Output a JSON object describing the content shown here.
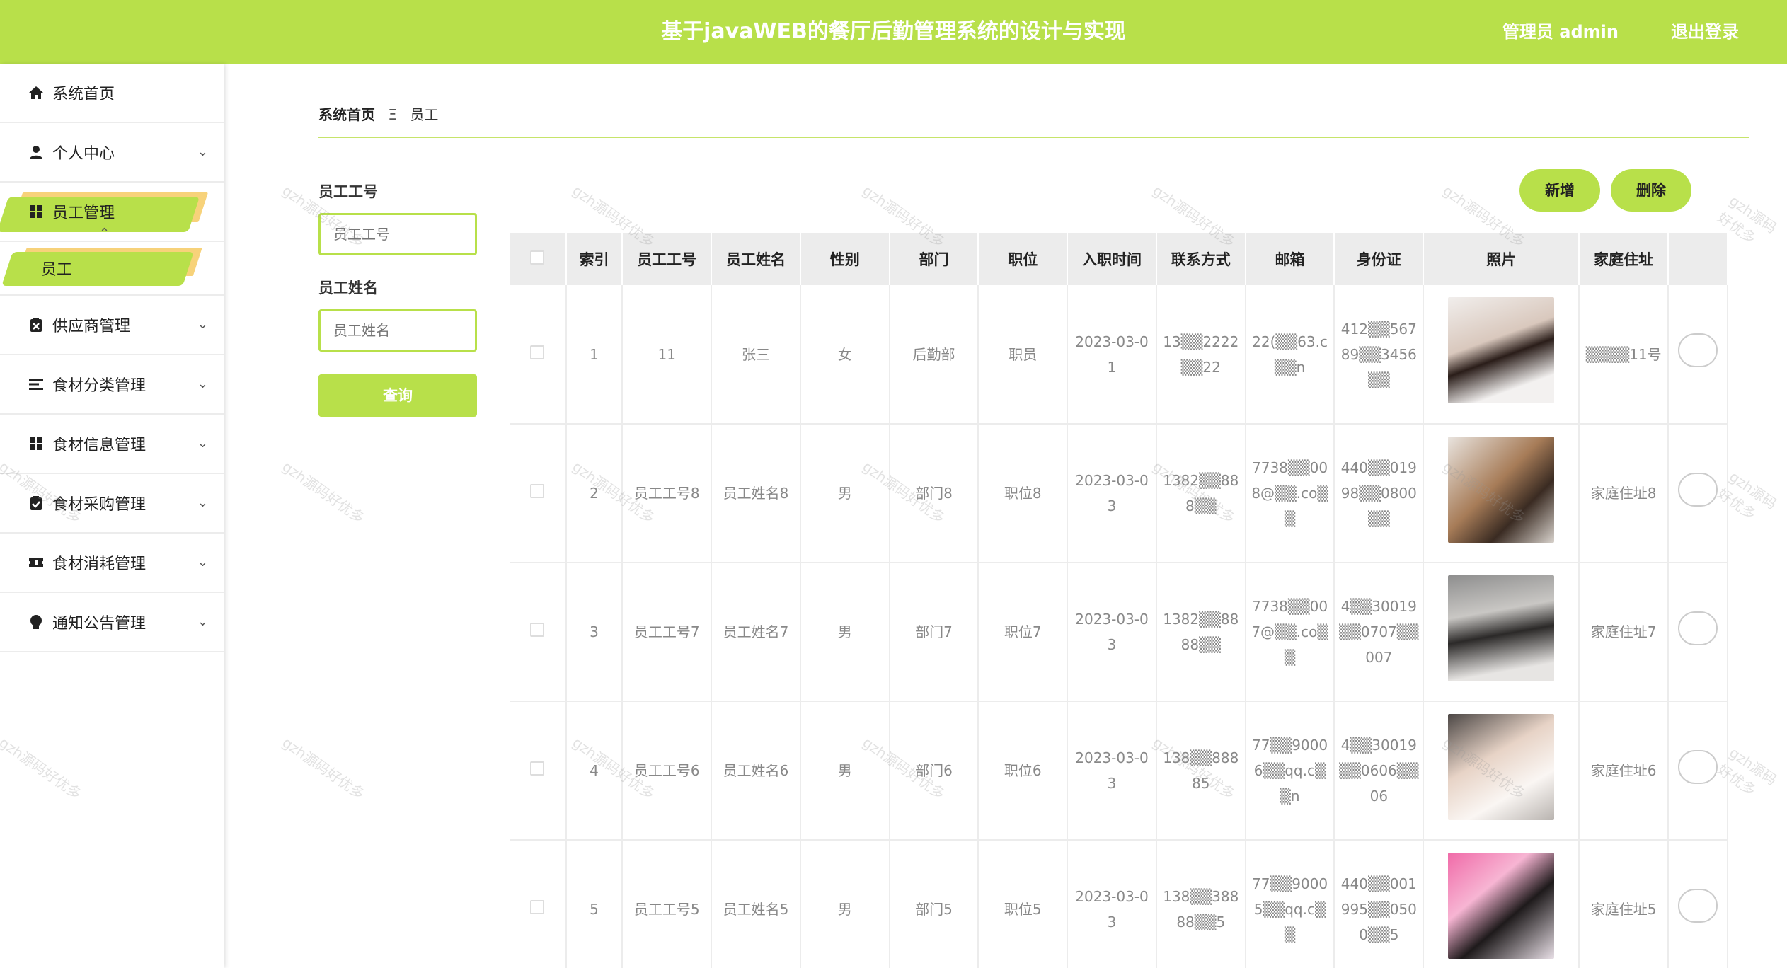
{
  "header": {
    "title": "基于javaWEB的餐厅后勤管理系统的设计与实现",
    "user_label": "管理员 admin",
    "logout_label": "退出登录"
  },
  "sidebar": {
    "items": [
      {
        "label": "系统首页",
        "icon": "home-icon"
      },
      {
        "label": "个人中心",
        "icon": "user-icon"
      },
      {
        "label": "员工管理",
        "icon": "grid-icon"
      },
      {
        "label": "员工",
        "icon": ""
      },
      {
        "label": "供应商管理",
        "icon": "clipboard-x-icon"
      },
      {
        "label": "食材分类管理",
        "icon": "list-icon"
      },
      {
        "label": "食材信息管理",
        "icon": "grid-icon"
      },
      {
        "label": "食材采购管理",
        "icon": "clipboard-check-icon"
      },
      {
        "label": "食材消耗管理",
        "icon": "ticket-icon"
      },
      {
        "label": "通知公告管理",
        "icon": "bulb-icon"
      }
    ]
  },
  "breadcrumb": {
    "home": "系统首页",
    "separator": "Ξ",
    "current": "员工"
  },
  "search": {
    "emp_no_label": "员工工号",
    "emp_no_placeholder": "员工工号",
    "emp_name_label": "员工姓名",
    "emp_name_placeholder": "员工姓名",
    "query_label": "查询"
  },
  "actions": {
    "add_label": "新增",
    "delete_label": "删除"
  },
  "table": {
    "headers": [
      "索引",
      "员工工号",
      "员工姓名",
      "性别",
      "部门",
      "职位",
      "入职时间",
      "联系方式",
      "邮箱",
      "身份证",
      "照片",
      "家庭住址"
    ],
    "rows": [
      {
        "index": "1",
        "emp_no": "11",
        "emp_name": "张三",
        "gender": "女",
        "dept": "后勤部",
        "position": "职员",
        "hire_date": "2023-03-01",
        "phone": "13▒▒2222▒▒22",
        "email": "22(▒▒63.c▒▒n",
        "id_card": "412▒▒56789▒▒3456▒▒",
        "address": "▒▒▒▒11号"
      },
      {
        "index": "2",
        "emp_no": "员工工号8",
        "emp_name": "员工姓名8",
        "gender": "男",
        "dept": "部门8",
        "position": "职位8",
        "hire_date": "2023-03-03",
        "phone": "1382▒▒888▒▒",
        "email": "7738▒▒008@▒▒.co▒▒",
        "id_card": "440▒▒01998▒▒0800▒▒",
        "address": "家庭住址8"
      },
      {
        "index": "3",
        "emp_no": "员工工号7",
        "emp_name": "员工姓名7",
        "gender": "男",
        "dept": "部门7",
        "position": "职位7",
        "hire_date": "2023-03-03",
        "phone": "1382▒▒8888▒▒",
        "email": "7738▒▒007@▒▒.co▒▒",
        "id_card": "4▒▒30019▒▒0707▒▒007",
        "address": "家庭住址7"
      },
      {
        "index": "4",
        "emp_no": "员工工号6",
        "emp_name": "员工姓名6",
        "gender": "男",
        "dept": "部门6",
        "position": "职位6",
        "hire_date": "2023-03-03",
        "phone": "138▒▒88885",
        "email": "77▒▒90006▒▒qq.c▒▒n",
        "id_card": "4▒▒30019▒▒0606▒▒06",
        "address": "家庭住址6"
      },
      {
        "index": "5",
        "emp_no": "员工工号5",
        "emp_name": "员工姓名5",
        "gender": "男",
        "dept": "部门5",
        "position": "职位5",
        "hire_date": "2023-03-03",
        "phone": "138▒▒38888▒▒5",
        "email": "77▒▒90005▒▒qq.c▒▒",
        "id_card": "440▒▒001995▒▒0500▒▒5",
        "address": "家庭住址5"
      }
    ]
  },
  "watermark_text": "gzh源码好优多",
  "colors": {
    "accent": "#b8e04a",
    "highlight_shadow": "#f7d27a",
    "header_text": "#ffffff"
  }
}
